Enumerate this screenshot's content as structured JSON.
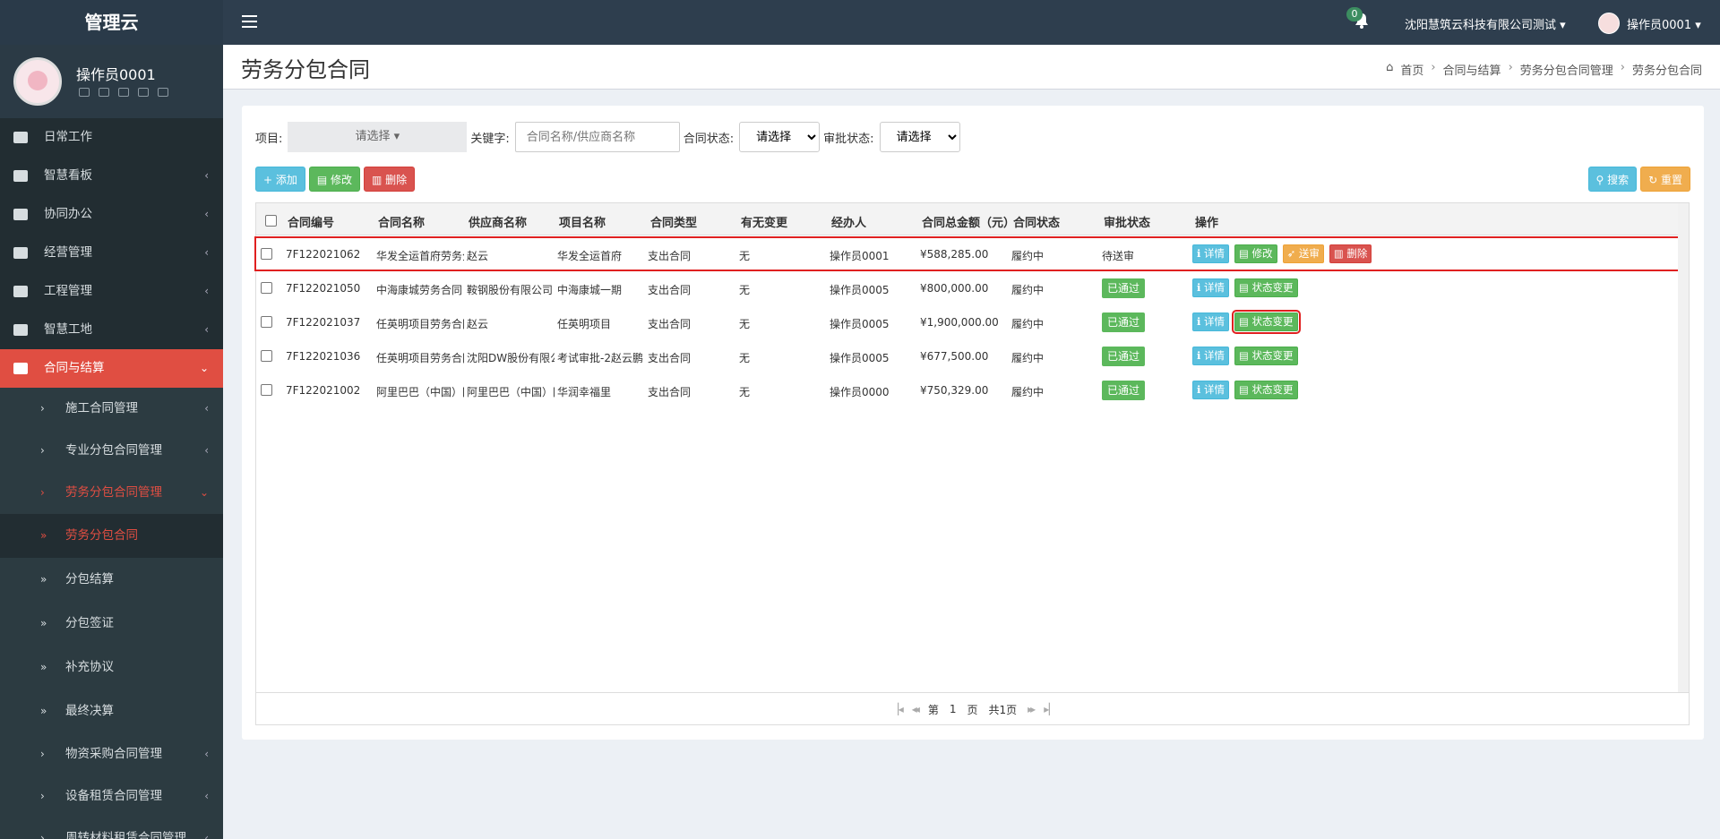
{
  "header": {
    "logo": "管理云",
    "notification_count": "0",
    "company": "沈阳慧筑云科技有限公司测试 ▾",
    "user": "操作员0001 ▾"
  },
  "sidebar": {
    "user_name": "操作员0001",
    "menu": [
      {
        "label": "日常工作",
        "icon": "list-icon"
      },
      {
        "label": "智慧看板",
        "icon": "dashboard-icon",
        "arrow": "‹"
      },
      {
        "label": "协同办公",
        "icon": "users-icon",
        "arrow": "‹"
      },
      {
        "label": "经营管理",
        "icon": "monitor-icon",
        "arrow": "‹"
      },
      {
        "label": "工程管理",
        "icon": "hammer-icon",
        "arrow": "‹"
      },
      {
        "label": "智慧工地",
        "icon": "monitor-icon",
        "arrow": "‹"
      },
      {
        "label": "合同与结算",
        "icon": "file-icon",
        "arrow": "⌄"
      }
    ],
    "submenu": [
      {
        "label": "施工合同管理",
        "marker": "›",
        "arrow": "‹"
      },
      {
        "label": "专业分包合同管理",
        "marker": "›",
        "arrow": "‹"
      },
      {
        "label": "劳务分包合同管理",
        "marker": "›",
        "arrow": "⌄"
      },
      {
        "label": "劳务分包合同",
        "marker": "»"
      },
      {
        "label": "分包结算",
        "marker": "»"
      },
      {
        "label": "分包签证",
        "marker": "»"
      },
      {
        "label": "补充协议",
        "marker": "»"
      },
      {
        "label": "最终决算",
        "marker": "»"
      },
      {
        "label": "物资采购合同管理",
        "marker": "›",
        "arrow": "‹"
      },
      {
        "label": "设备租赁合同管理",
        "marker": "›",
        "arrow": "‹"
      },
      {
        "label": "周转材料租赁合同管理",
        "marker": "›",
        "arrow": "‹"
      }
    ]
  },
  "page": {
    "title": "劳务分包合同",
    "breadcrumb": [
      "首页",
      "合同与结算",
      "劳务分包合同管理",
      "劳务分包合同"
    ]
  },
  "filters": {
    "project_label": "项目:",
    "project_value": "请选择 ▾",
    "keyword_label": "关键字:",
    "keyword_placeholder": "合同名称/供应商名称",
    "contract_status_label": "合同状态:",
    "contract_status_value": "请选择",
    "approval_status_label": "审批状态:",
    "approval_status_value": "请选择"
  },
  "toolbar": {
    "add": "+ 添加",
    "edit": "▤ 修改",
    "delete": "▥ 删除",
    "search": "⚲ 搜索",
    "reset": "↻ 重置"
  },
  "table": {
    "columns": [
      "合同编号",
      "合同名称",
      "供应商名称",
      "项目名称",
      "合同类型",
      "有无变更",
      "经办人",
      "合同总金额（元）",
      "合同状态",
      "审批状态",
      "操作"
    ],
    "rows": [
      {
        "code": "7F122021062",
        "name": "华发全运首府劳务分包",
        "supplier": "赵云",
        "project": "华发全运首府",
        "type": "支出合同",
        "change": "无",
        "handler": "操作员0001",
        "amount": "¥588,285.00",
        "status": "履约中",
        "approval": "待送审",
        "approval_tag": false,
        "actions": [
          "ℹ 详情",
          "▤ 修改",
          "➶ 送审",
          "▥ 删除"
        ]
      },
      {
        "code": "7F122021050",
        "name": "中海康城劳务合同",
        "supplier": "鞍钢股份有限公司",
        "project": "中海康城一期",
        "type": "支出合同",
        "change": "无",
        "handler": "操作员0005",
        "amount": "¥800,000.00",
        "status": "履约中",
        "approval": "已通过",
        "approval_tag": true,
        "actions": [
          "ℹ 详情",
          "▤ 状态变更"
        ]
      },
      {
        "code": "7F122021037",
        "name": "任英明项目劳务合同（",
        "supplier": "赵云",
        "project": "任英明项目",
        "type": "支出合同",
        "change": "无",
        "handler": "操作员0005",
        "amount": "¥1,900,000.00",
        "status": "履约中",
        "approval": "已通过",
        "approval_tag": true,
        "actions": [
          "ℹ 详情",
          "▤ 状态变更"
        ]
      },
      {
        "code": "7F122021036",
        "name": "任英明项目劳务合同（",
        "supplier": "沈阳DW股份有限公司",
        "project": "考试审批-2赵云鹏",
        "type": "支出合同",
        "change": "无",
        "handler": "操作员0005",
        "amount": "¥677,500.00",
        "status": "履约中",
        "approval": "已通过",
        "approval_tag": true,
        "actions": [
          "ℹ 详情",
          "▤ 状态变更"
        ]
      },
      {
        "code": "7F122021002",
        "name": "阿里巴巴（中国）网络",
        "supplier": "阿里巴巴（中国）网络",
        "project": "华润幸福里",
        "type": "支出合同",
        "change": "无",
        "handler": "操作员0000",
        "amount": "¥750,329.00",
        "status": "履约中",
        "approval": "已通过",
        "approval_tag": true,
        "actions": [
          "ℹ 详情",
          "▤ 状态变更"
        ]
      }
    ]
  },
  "pager": {
    "first": "⎮◂",
    "prev": "◂◂",
    "page_prefix": "第",
    "page_value": "1",
    "page_suffix": "页",
    "total": "共1页",
    "next": "▸▸",
    "last": "▸⎮"
  }
}
